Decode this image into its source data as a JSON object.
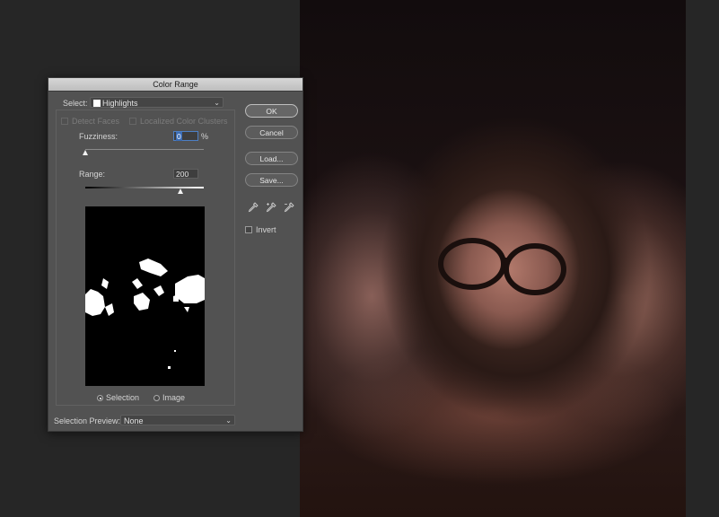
{
  "dialog": {
    "title": "Color Range",
    "select_label": "Select:",
    "select_value": "Highlights",
    "detect_faces_label": "Detect Faces",
    "localized_label": "Localized Color Clusters",
    "fuzziness_label": "Fuzziness:",
    "fuzziness_value": "0",
    "fuzziness_unit": "%",
    "range_label": "Range:",
    "range_value": "200",
    "range_fraction": 0.8,
    "fuzziness_fraction": 0.0,
    "radio_selection": "Selection",
    "radio_image": "Image",
    "selected_mode": "Selection",
    "preview_label": "Selection Preview:",
    "preview_value": "None",
    "invert_label": "Invert",
    "buttons": {
      "ok": "OK",
      "cancel": "Cancel",
      "load": "Load...",
      "save": "Save..."
    },
    "icons": [
      "eyedropper-icon",
      "eyedropper-plus-icon",
      "eyedropper-minus-icon"
    ]
  },
  "colors": {
    "dialog_bg": "#525252",
    "accent": "#3b6cb5"
  }
}
